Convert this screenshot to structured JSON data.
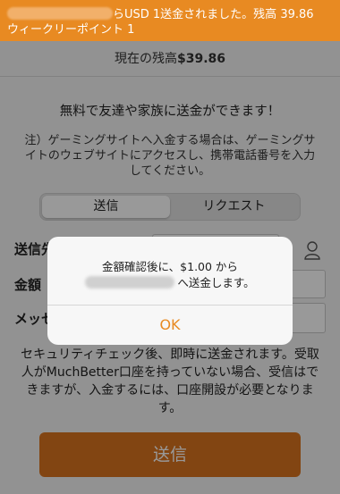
{
  "banner": {
    "line1": "らUSD 1送金されました。残高 39.86",
    "line2": "ウィークリーポイント 1"
  },
  "balance": {
    "label": "現在の残高",
    "amount": "$39.86"
  },
  "headline": "無料で友達や家族に送金ができます！",
  "note": "注）ゲーミングサイトへ入金する場合は、ゲーミングサイトのウェブサイトにアクセスし、携帯電話番号を入力してください。",
  "tabs": [
    "送信",
    "リクエスト"
  ],
  "form": {
    "to_label": "送信先",
    "amount_label": "金額",
    "message_label": "メッセージ"
  },
  "description": "セキュリティチェック後、即時に送金されます。受取人がMuchBetter口座を持っていない場合、受信はできますが、入金するには、口座開設が必要となります。",
  "send_button": "送信",
  "dialog": {
    "line1": "金額確認後に、$1.00 から",
    "line2": "へ送金します。",
    "ok": "OK"
  },
  "colors": {
    "accent": "#e88a22",
    "send_button": "#d9731f"
  },
  "icons": {
    "contact": "person-icon"
  }
}
